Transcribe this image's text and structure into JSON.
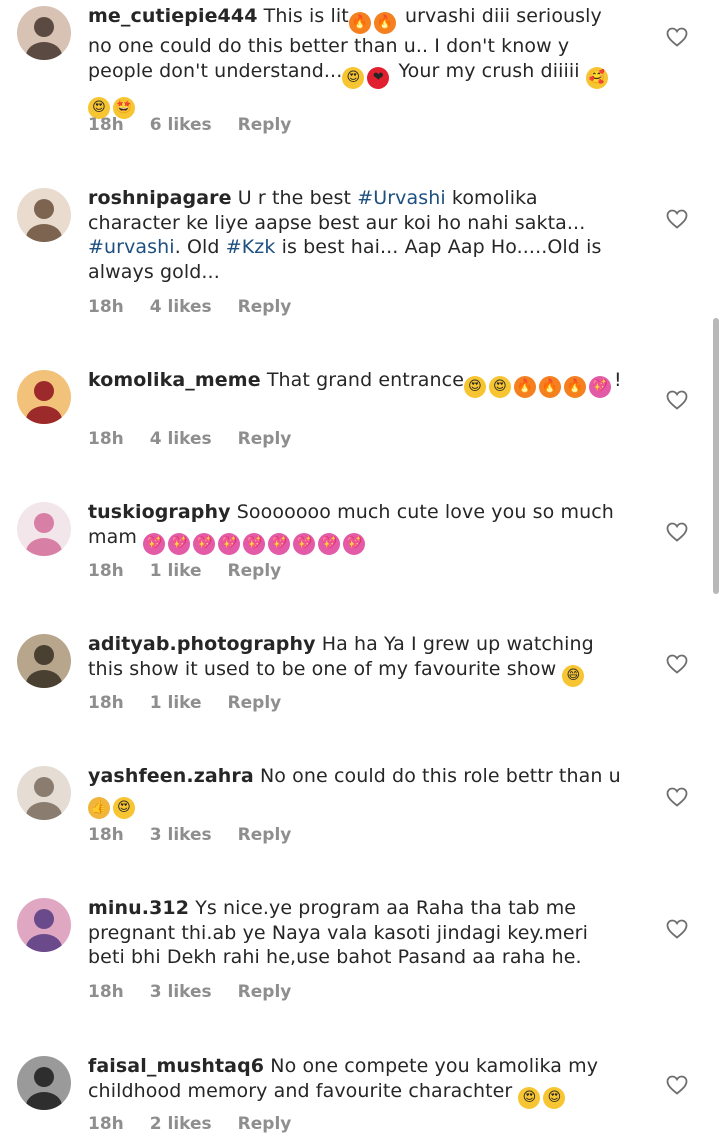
{
  "comments": [
    {
      "username": "me_cutiepie444",
      "segments": [
        {
          "t": "This is lit"
        },
        {
          "e": "fire"
        },
        {
          "e": "fire"
        },
        {
          "t": " urvashi diii seriously no one could do this better than u.. I don't know y people don't understand..."
        },
        {
          "e": "heart-eyes"
        },
        {
          "e": "red-heart"
        },
        {
          "t": " Your my crush diiiii "
        },
        {
          "e": "smiling-hearts"
        },
        {
          "e": "heart-eyes"
        },
        {
          "e": "star-struck"
        }
      ],
      "time": "18h",
      "likes": "6 likes",
      "reply": "Reply"
    },
    {
      "username": "roshnipagare",
      "segments": [
        {
          "t": "U r the best "
        },
        {
          "h": "#Urvashi"
        },
        {
          "t": " komolika character ke liye aapse best aur koi ho nahi sakta... "
        },
        {
          "h": "#urvashi"
        },
        {
          "t": ". Old "
        },
        {
          "h": "#Kzk"
        },
        {
          "t": " is best hai... Aap Aap Ho.....Old is always gold..."
        }
      ],
      "time": "18h",
      "likes": "4 likes",
      "reply": "Reply"
    },
    {
      "username": "komolika_meme",
      "segments": [
        {
          "t": "That grand entrance"
        },
        {
          "e": "heart-eyes"
        },
        {
          "e": "heart-eyes"
        },
        {
          "e": "fire"
        },
        {
          "e": "fire"
        },
        {
          "e": "fire"
        },
        {
          "e": "sparkling-heart"
        },
        {
          "t": "!"
        }
      ],
      "time": "18h",
      "likes": "4 likes",
      "reply": "Reply"
    },
    {
      "username": "tuskiography",
      "segments": [
        {
          "t": "Sooooooo much cute love you so much mam "
        },
        {
          "e": "sparkling-heart"
        },
        {
          "e": "sparkling-heart"
        },
        {
          "e": "sparkling-heart"
        },
        {
          "e": "sparkling-heart"
        },
        {
          "e": "sparkling-heart"
        },
        {
          "e": "sparkling-heart"
        },
        {
          "e": "sparkling-heart"
        },
        {
          "e": "sparkling-heart"
        },
        {
          "e": "sparkling-heart"
        }
      ],
      "time": "18h",
      "likes": "1 like",
      "reply": "Reply"
    },
    {
      "username": "adityab.photography",
      "segments": [
        {
          "t": "Ha ha Ya I grew up watching this show it used to be one of my favourite show "
        },
        {
          "e": "grinning"
        }
      ],
      "time": "18h",
      "likes": "1 like",
      "reply": "Reply"
    },
    {
      "username": "yashfeen.zahra",
      "segments": [
        {
          "t": "No one could do this role bettr than u "
        },
        {
          "e": "thumbs-up"
        },
        {
          "e": "heart-eyes"
        }
      ],
      "time": "18h",
      "likes": "3 likes",
      "reply": "Reply"
    },
    {
      "username": "minu.312",
      "segments": [
        {
          "t": "Ys nice.ye program aa Raha tha tab me pregnant thi.ab ye Naya vala kasoti jindagi key.meri beti bhi Dekh rahi he,use bahot Pasand aa raha he."
        }
      ],
      "time": "18h",
      "likes": "3 likes",
      "reply": "Reply"
    },
    {
      "username": "faisal_mushtaq6",
      "segments": [
        {
          "t": "No one compete you kamolika my childhood memory and favourite charachter "
        },
        {
          "e": "heart-eyes"
        },
        {
          "e": "heart-eyes"
        }
      ],
      "time": "18h",
      "likes": "2 likes",
      "reply": "Reply"
    }
  ],
  "emoji_colors": {
    "fire": "#f4801f",
    "heart-eyes": "#f7c531",
    "red-heart": "#e0202e",
    "smiling-hearts": "#f7c531",
    "star-struck": "#f7c531",
    "sparkling-heart": "#e35aa6",
    "grinning": "#f7c531",
    "thumbs-up": "#f0b53a"
  },
  "hashtag_color": "#1d4f80",
  "muted_color": "#8e8e8e"
}
